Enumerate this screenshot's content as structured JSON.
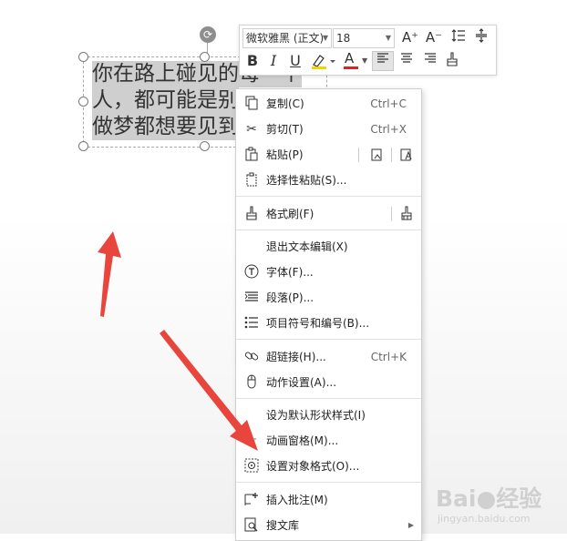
{
  "textbox": {
    "lines": [
      "你在路上碰见的每一个",
      "人，都可能是别",
      "做梦都想要见到"
    ]
  },
  "toolbar": {
    "font_name": "微软雅黑 (正文)",
    "font_size": "18",
    "grow_font": "A⁺",
    "shrink_font": "A⁻",
    "bold": "B",
    "italic": "I",
    "underline": "U",
    "font_color": "A"
  },
  "menu": {
    "copy": {
      "label": "复制(C)",
      "shortcut": "Ctrl+C"
    },
    "cut": {
      "label": "剪切(T)",
      "shortcut": "Ctrl+X"
    },
    "paste": {
      "label": "粘贴(P)"
    },
    "paste_special": {
      "label": "选择性粘贴(S)..."
    },
    "format_painter": {
      "label": "格式刷(F)"
    },
    "exit_edit": {
      "label": "退出文本编辑(X)"
    },
    "font": {
      "label": "字体(F)..."
    },
    "paragraph": {
      "label": "段落(P)..."
    },
    "bullets": {
      "label": "项目符号和编号(B)..."
    },
    "hyperlink": {
      "label": "超链接(H)...",
      "shortcut": "Ctrl+K"
    },
    "action": {
      "label": "动作设置(A)..."
    },
    "default_style": {
      "label": "设为默认形状样式(I)"
    },
    "animation_pane": {
      "label": "动画窗格(M)..."
    },
    "format_object": {
      "label": "设置对象格式(O)..."
    },
    "insert_comment": {
      "label": "插入批注(M)"
    },
    "doc_library": {
      "label": "搜文库"
    }
  },
  "watermark": {
    "logo": "Bai●经验",
    "sub": "jingyan.baidu.com"
  },
  "colors": {
    "arrow": "#e8453c",
    "highlight_bar": "#f2d500",
    "font_color_bar": "#e02020",
    "selection_bg": "#cfcfcf"
  }
}
